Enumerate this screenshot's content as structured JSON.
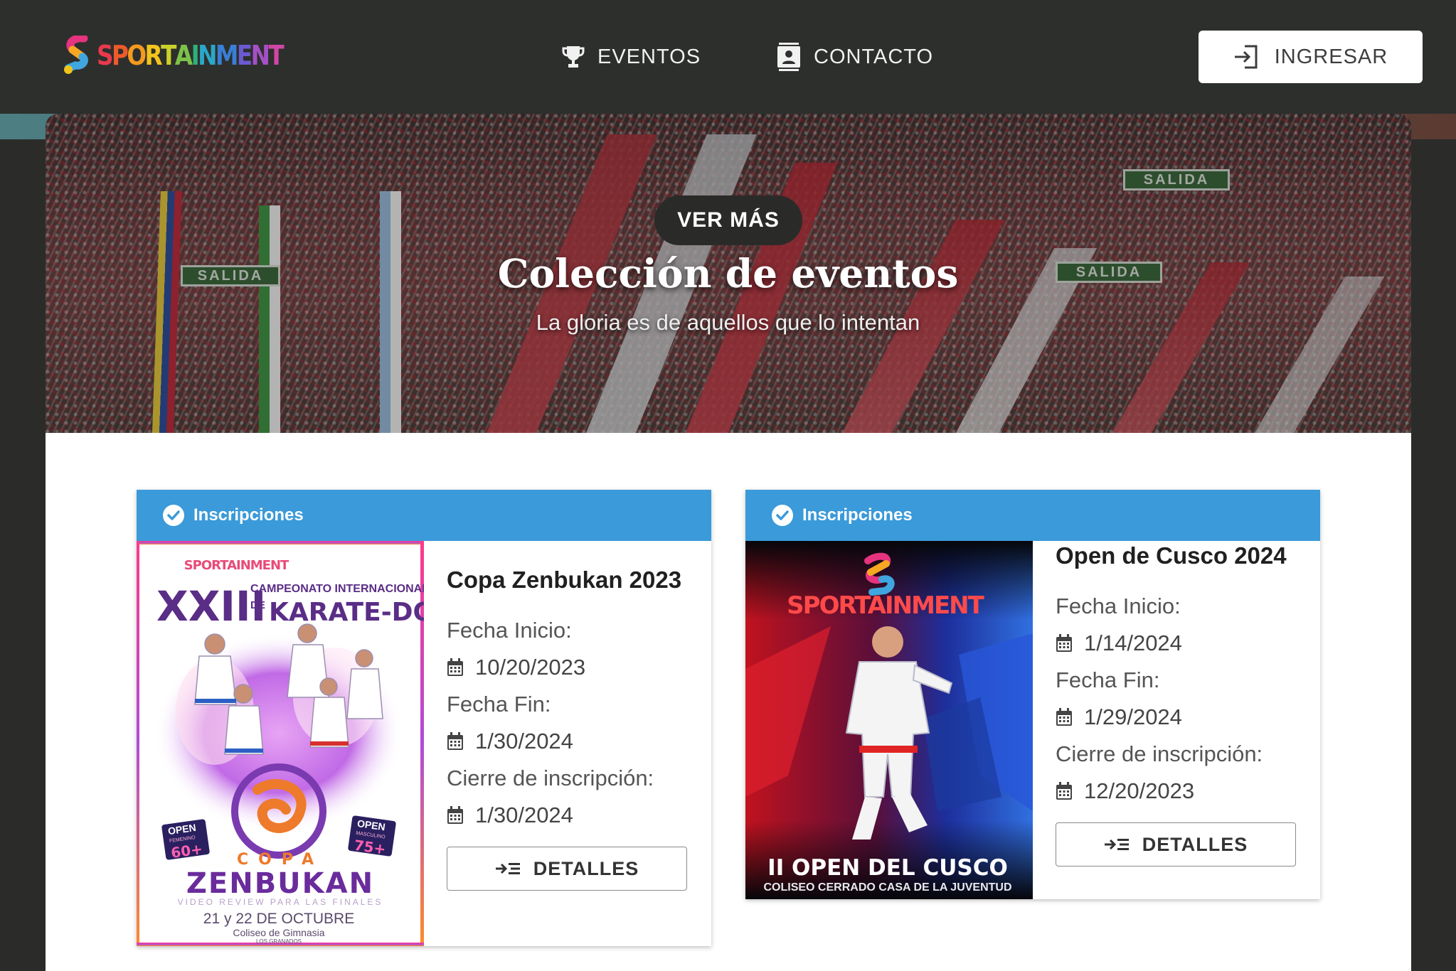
{
  "header": {
    "brand": "SPORTAINMENT",
    "nav": [
      {
        "label": "EVENTOS",
        "icon": "trophy-icon"
      },
      {
        "label": "CONTACTO",
        "icon": "contact-card-icon"
      }
    ],
    "login_label": "INGRESAR",
    "login_icon": "login-icon"
  },
  "hero": {
    "button_label": "VER MÁS",
    "title": "Colección de eventos",
    "subtitle": "La gloria es de aquellos que lo intentan",
    "signs": [
      "SALIDA",
      "SALIDA",
      "SALIDA"
    ]
  },
  "events": [
    {
      "status": "Inscripciones",
      "title": "Copa Zenbukan 2023",
      "start_label": "Fecha Inicio:",
      "start_date": "10/20/2023",
      "end_label": "Fecha Fin:",
      "end_date": "1/30/2024",
      "close_label": "Cierre de inscripción:",
      "close_date": "1/30/2024",
      "details_label": "DETALLES",
      "poster": {
        "brand": "SPORTAINMENT",
        "roman": "XXIII",
        "line1": "CAMPEONATO INTERNACIONAL",
        "line2": "KARATE-DO",
        "de": "DE",
        "open_f": "OPEN",
        "open_f_sub": "FEMENINO",
        "open_f_num": "60+",
        "open_m": "OPEN",
        "open_m_sub": "MASCULINO",
        "open_m_num": "75+",
        "copa": "COPA",
        "name": "ZENBUKAN",
        "review": "VIDEO REVIEW PARA LAS FINALES",
        "dates": "21 y 22 DE OCTUBRE",
        "venue": "Coliseo de Gimnasia",
        "venue_sub": "LOS GRANADOS"
      }
    },
    {
      "status": "Inscripciones",
      "title": "Open de Cusco 2024",
      "start_label": "Fecha Inicio:",
      "start_date": "1/14/2024",
      "end_label": "Fecha Fin:",
      "end_date": "1/29/2024",
      "close_label": "Cierre de inscripción:",
      "close_date": "12/20/2023",
      "details_label": "DETALLES",
      "poster": {
        "brand": "SPORTAINMENT",
        "title": "II OPEN DEL CUSCO",
        "venue": "COLISEO CERRADO CASA DE LA JUVENTUD"
      }
    }
  ],
  "colors": {
    "header_bg": "#2d2f2c",
    "status_blue": "#3b9ad9",
    "page_bg": "#2b2c2a"
  }
}
